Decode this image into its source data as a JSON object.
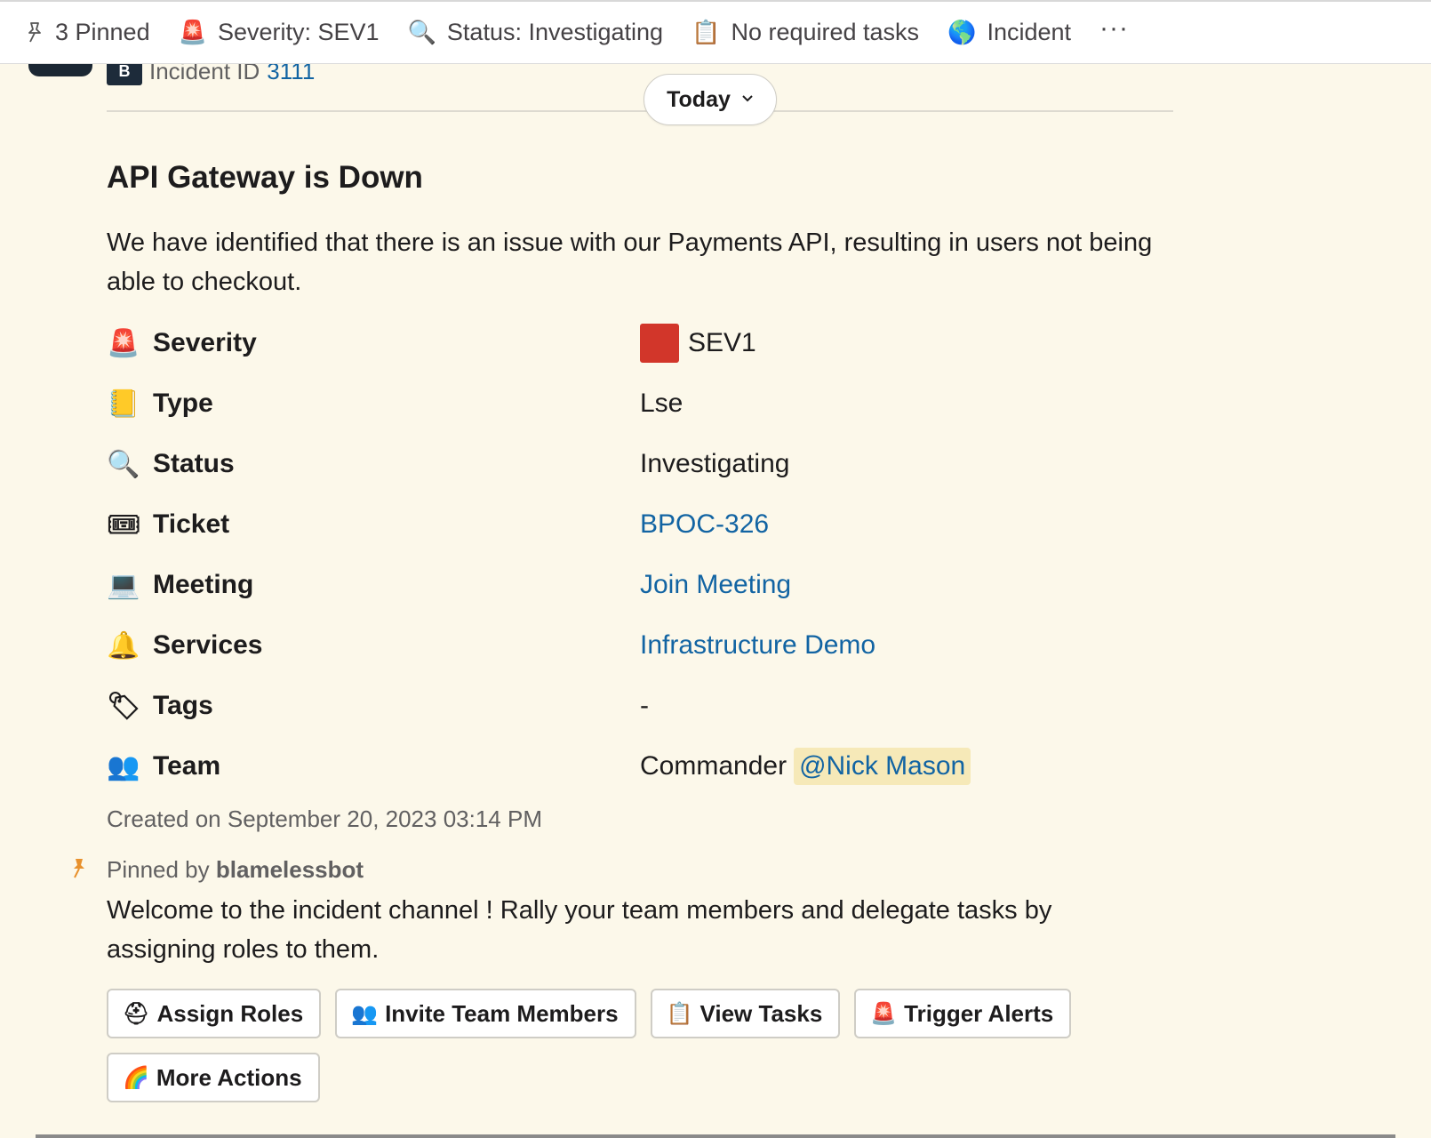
{
  "topbar": {
    "pinned": {
      "label": "3 Pinned",
      "icon": "pin-icon"
    },
    "severity": {
      "label": "Severity: SEV1",
      "icon": "rotating-light-icon"
    },
    "status": {
      "label": "Status: Investigating",
      "icon": "magnifier-icon"
    },
    "tasks": {
      "label": "No required tasks",
      "icon": "clipboard-icon"
    },
    "incident": {
      "label": "Incident",
      "icon": "globe-icon"
    },
    "more": "···"
  },
  "header": {
    "incident_id_label": "Incident ID",
    "incident_id": "3111",
    "logo_glyph": "B"
  },
  "divider": {
    "label": "Today",
    "chevron": "⌄"
  },
  "message": {
    "title": "API Gateway is Down",
    "description": "We have identified that there is an issue with our Payments API, resulting in users not being able to checkout.",
    "fields": [
      {
        "label": "Severity",
        "icon": "rotating-light-icon",
        "value": "SEV1",
        "severity_color": "#d2362a"
      },
      {
        "label": "Type",
        "icon": "ledger-icon",
        "value": "Lse"
      },
      {
        "label": "Status",
        "icon": "magnifier-icon",
        "value": "Investigating"
      },
      {
        "label": "Ticket",
        "icon": "ticket-icon",
        "value": "BPOC-326"
      },
      {
        "label": "Meeting",
        "icon": "laptop-icon",
        "value": "Join Meeting"
      },
      {
        "label": "Services",
        "icon": "bell-icon",
        "value": "Infrastructure Demo"
      },
      {
        "label": "Tags",
        "icon": "label-tag-icon",
        "value": "-"
      },
      {
        "label": "Team",
        "icon": "people-icon",
        "value_prefix": "Commander",
        "mention": "@Nick Mason"
      }
    ],
    "created": "Created on September 20, 2023 03:14 PM"
  },
  "pinned_message": {
    "pinned_by_prefix": "Pinned by",
    "pinned_by_user": "blamelessbot",
    "text": "Welcome to the incident channel ! Rally your team members and delegate tasks by assigning roles to them.",
    "buttons": [
      {
        "label": "Assign Roles",
        "icon": "rescue-helmet-icon"
      },
      {
        "label": "Invite Team Members",
        "icon": "people-icon"
      },
      {
        "label": "View Tasks",
        "icon": "clipboard-icon"
      },
      {
        "label": "Trigger Alerts",
        "icon": "rotating-light-icon"
      },
      {
        "label": "More Actions",
        "icon": "rainbow-icon"
      }
    ]
  },
  "colors": {
    "background": "#fcf8ea",
    "link": "#1264a3",
    "mention_bg": "#f6e9b8",
    "pin_accent": "#e8912d"
  }
}
